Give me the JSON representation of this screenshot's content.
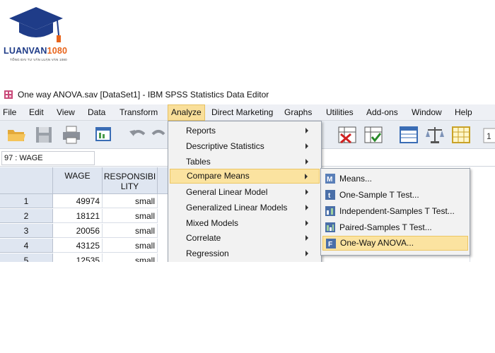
{
  "logo": {
    "text_a": "LUANVAN",
    "text_b": "1080",
    "tagline": "TỔNG ĐÀI TƯ VẤN LUẬN VĂN 1080"
  },
  "window": {
    "title": "One way ANOVA.sav [DataSet1] - IBM SPSS Statistics Data Editor"
  },
  "menubar": {
    "items": [
      "File",
      "Edit",
      "View",
      "Data",
      "Transform",
      "Analyze",
      "Direct Marketing",
      "Graphs",
      "Utilities",
      "Add-ons",
      "Window",
      "Help"
    ],
    "active": "Analyze"
  },
  "cellref": {
    "value": "97 : WAGE"
  },
  "grid": {
    "columns": [
      "WAGE",
      "RESPONSIBI LITY"
    ],
    "rows": [
      {
        "n": "1",
        "wage": "49974",
        "resp": "small"
      },
      {
        "n": "2",
        "wage": "18121",
        "resp": "small"
      },
      {
        "n": "3",
        "wage": "20056",
        "resp": "small"
      },
      {
        "n": "4",
        "wage": "43125",
        "resp": "small"
      },
      {
        "n": "5",
        "wage": "12535",
        "resp": "small"
      }
    ]
  },
  "analyze_menu": {
    "items": [
      "Reports",
      "Descriptive Statistics",
      "Tables",
      "Compare Means",
      "General Linear Model",
      "Generalized Linear Models",
      "Mixed Models",
      "Correlate",
      "Regression"
    ],
    "highlighted": "Compare Means"
  },
  "compare_means_menu": {
    "items": [
      "Means...",
      "One-Sample T Test...",
      "Independent-Samples T Test...",
      "Paired-Samples T Test...",
      "One-Way ANOVA..."
    ],
    "highlighted": "One-Way ANOVA..."
  },
  "colors": {
    "menu_highlight": "#fbe3a0",
    "header_bg": "#dfe6f1",
    "logo_blue": "#1f3c88",
    "logo_orange": "#e8641b"
  }
}
